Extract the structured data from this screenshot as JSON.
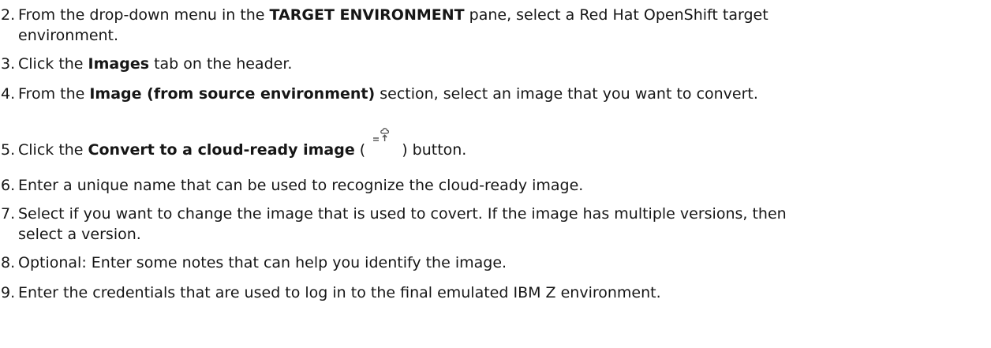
{
  "steps": [
    {
      "num": "2.",
      "pre": "From the drop-down menu in the ",
      "bold": "TARGET ENVIRONMENT",
      "post": " pane, select a Red Hat OpenShift target",
      "cont": "environment."
    },
    {
      "num": "3.",
      "pre": "Click the ",
      "bold": "Images",
      "post": " tab on the header."
    },
    {
      "num": "4.",
      "pre": "From the ",
      "bold": "Image (from source environment)",
      "post": " section, select an image that you want to convert."
    },
    {
      "num": "5.",
      "pre": "Click the ",
      "bold": "Convert to a cloud-ready image",
      "mid": " (",
      "icon": "convert-to-cloud-ready-icon",
      "post": ") button."
    },
    {
      "num": "6.",
      "text": "Enter a unique name that can be used to recognize the cloud-ready image."
    },
    {
      "num": "7.",
      "text": "Select if you want to change the image that is used to covert. If the image has multiple versions, then",
      "cont": "select a version."
    },
    {
      "num": "8.",
      "text": "Optional: Enter some notes that can help you identify the image."
    },
    {
      "num": "9.",
      "text": "Enter the credentials that are used to log in to the final emulated IBM Z environment."
    }
  ]
}
